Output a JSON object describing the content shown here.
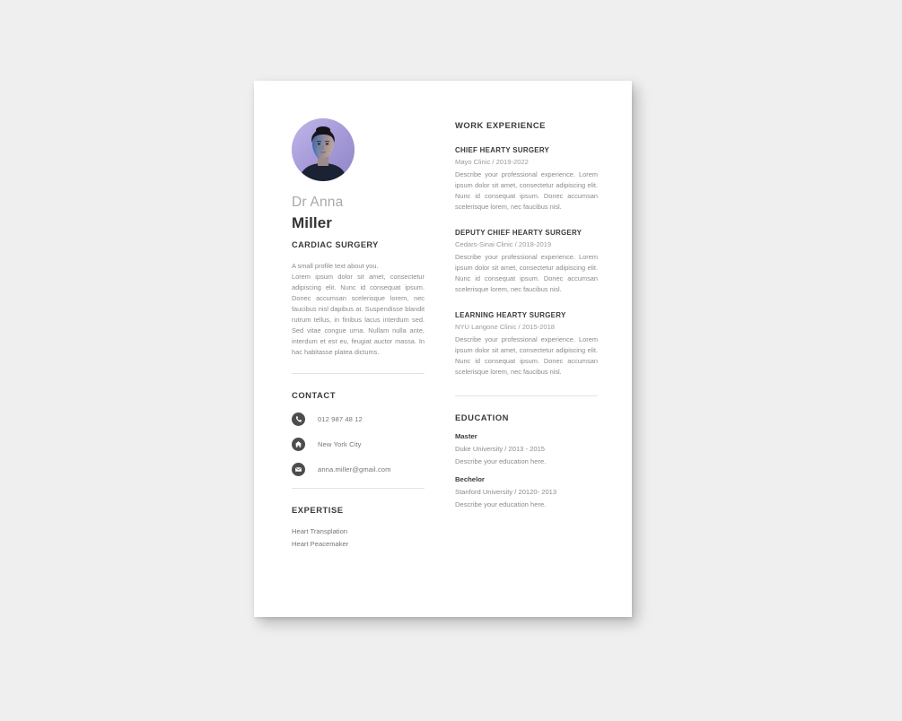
{
  "theme": {
    "page_background": "#efefef",
    "sheet_background": "#ffffff",
    "heading_color": "#3a3a3a",
    "body_text_color": "#8b8b8b",
    "muted_text_color": "#9b9b9b",
    "icon_badge_color": "#4d4d4d",
    "divider_color": "#e3e3e3",
    "avatar_gradient_from": "#b9aee0",
    "avatar_gradient_to": "#8f86c6"
  },
  "profile": {
    "avatar_icon": "portrait-photo",
    "first_name": "Dr Anna",
    "last_name": "Miller",
    "job_title": "CARDIAC SURGERY",
    "intro_line": "A small profile text about you.",
    "body_text": "Lorem ipsum dolor sit amet, consectetur adipiscing elit. Nunc id consequat ipsum. Donec accumsan scelerisque lorem, nec faucibus nisl dapibus at. Suspendisse blandit rutrum tellus, in finibus lacus interdum sed. Sed vitae congue urna. Nullam nulla ante, interdum et est eu, feugiat auctor massa. In hac habitasse platea dictums."
  },
  "contact": {
    "heading": "CONTACT",
    "items": [
      {
        "icon": "phone-icon",
        "value": "012 987 48 12"
      },
      {
        "icon": "home-icon",
        "value": "New York City"
      },
      {
        "icon": "envelope-icon",
        "value": "anna.miller@gmail.com"
      }
    ]
  },
  "expertise": {
    "heading": "EXPERTISE",
    "items": [
      {
        "label": "Heart Transplation"
      },
      {
        "label": "Heart Peacemaker"
      }
    ]
  },
  "work_experience": {
    "heading": "WORK EXPERIENCE",
    "jobs": [
      {
        "role": "CHIEF HEARTY SURGERY",
        "meta": "Mayo Clinic / 2019-2022",
        "description": "Describe your professional experience. Lorem ipsum dolor sit amet, consectetur adipiscing elit. Nunc id consequat ipsum. Donec accumsan scelerisque lorem, nec faucibus nisl."
      },
      {
        "role": "DEPUTY CHIEF HEARTY SURGERY",
        "meta": "Cedars-Sinai Clinic / 2018-2019",
        "description": "Describe your professional experience. Lorem ipsum dolor sit amet, consectetur adipiscing elit. Nunc id consequat ipsum. Donec accumsan scelerisque lorem, nec faucibus nisl."
      },
      {
        "role": "LEARNING HEARTY SURGERY",
        "meta": "NYU Langone Clinic / 2015-2018",
        "description": "Describe your professional experience. Lorem ipsum dolor sit amet, consectetur adipiscing elit. Nunc id consequat ipsum. Donec accumsan scelerisque lorem, nec faucibus nisl."
      }
    ]
  },
  "education": {
    "heading": "EDUCATION",
    "entries": [
      {
        "degree": "Master",
        "school": "Duke University / 2013 - 2015",
        "note": "Describe your education here."
      },
      {
        "degree": "Bechelor",
        "school": "Stanford University / 20120- 2013",
        "note": "Describe your education here."
      }
    ]
  }
}
